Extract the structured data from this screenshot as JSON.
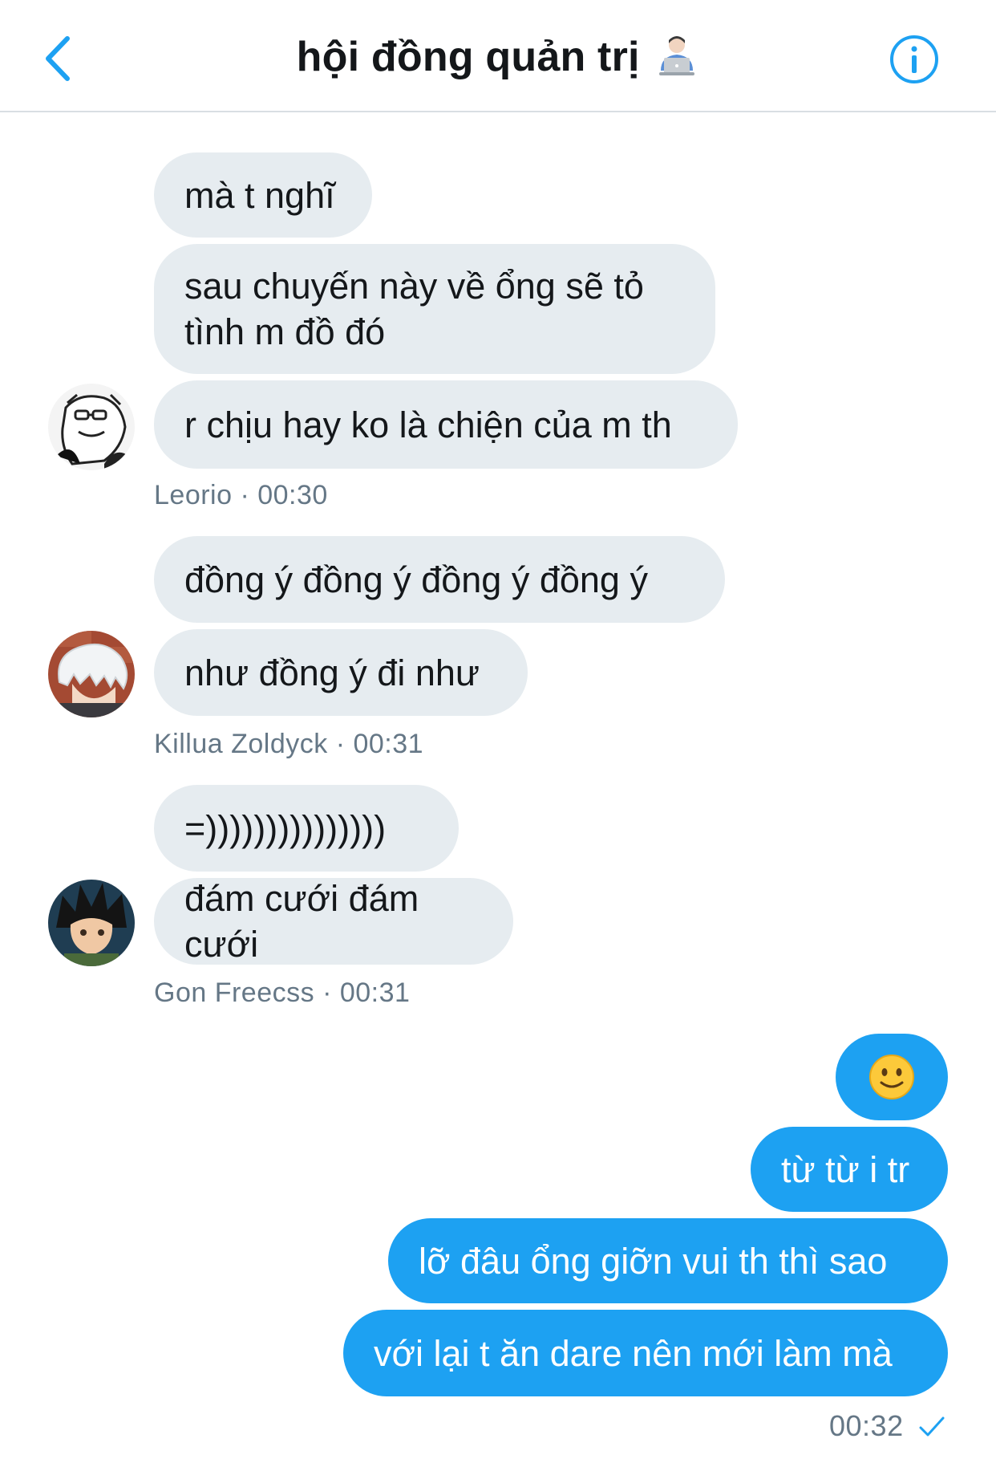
{
  "header": {
    "title": "hội đồng quản trị",
    "back_icon": "chevron-left-icon",
    "info_icon": "info-icon",
    "accent_color": "#1da1f2"
  },
  "messages": {
    "leorio": {
      "bubbles": [
        "mà t nghĩ",
        "sau chuyến này về ổng sẽ tỏ",
        "tình m đồ đó",
        "r chịu hay ko là chiện của m th"
      ],
      "meta": "Leorio · 00:30"
    },
    "killua": {
      "bubbles": [
        "đồng ý đồng ý đồng ý đồng ý",
        "như đồng ý đi như"
      ],
      "meta": "Killua Zoldyck · 00:31"
    },
    "gon": {
      "bubbles": [
        "=)))))))))))))))",
        "đám cưới đám cưới"
      ],
      "meta": "Gon Freecss · 00:31"
    },
    "me": {
      "bubbles": [
        "🙂",
        "từ từ i tr",
        "lỡ đâu ổng giỡn vui th thì sao",
        "với lại t ăn dare nên mới làm mà"
      ],
      "time": "00:32",
      "status_icon": "checkmark-icon"
    }
  },
  "colors": {
    "incoming_bubble": "#e6ecf0",
    "outgoing_bubble": "#1da1f2",
    "meta_text": "#657786"
  }
}
